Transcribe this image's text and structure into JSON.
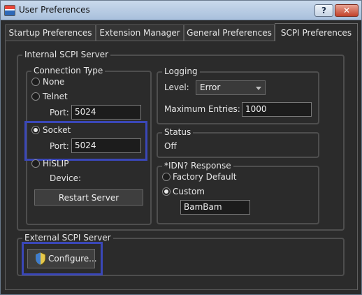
{
  "window": {
    "title": "User Preferences",
    "help_label": "?",
    "close_label": "✕"
  },
  "tabs": [
    {
      "label": "Startup Preferences",
      "active": false
    },
    {
      "label": "Extension Manager",
      "active": false
    },
    {
      "label": "General Preferences",
      "active": false
    },
    {
      "label": "SCPI Preferences",
      "active": true
    }
  ],
  "internal_scpi": {
    "title": "Internal SCPI Server",
    "connection_type": {
      "title": "Connection Type",
      "none_label": "None",
      "telnet_label": "Telnet",
      "telnet_port_label": "Port:",
      "telnet_port": "5024",
      "socket_label": "Socket",
      "socket_port_label": "Port:",
      "socket_port": "5024",
      "hislip_label": "HiSLIP",
      "device_label": "Device:",
      "selected": "Socket"
    },
    "restart_label": "Restart Server",
    "logging": {
      "title": "Logging",
      "level_label": "Level:",
      "level_value": "Error",
      "max_entries_label": "Maximum Entries:",
      "max_entries_value": "1000"
    },
    "status": {
      "title": "Status",
      "value": "Off"
    },
    "idn": {
      "title": "*IDN? Response",
      "factory_label": "Factory Default",
      "custom_label": "Custom",
      "custom_value": "BamBam",
      "selected": "Custom"
    }
  },
  "external_scpi": {
    "title": "External SCPI Server",
    "configure_label": "Configure..."
  },
  "colors": {
    "highlight": "#3a47b8",
    "background": "#2b2b2b",
    "titlebar": "#b9cce4"
  }
}
